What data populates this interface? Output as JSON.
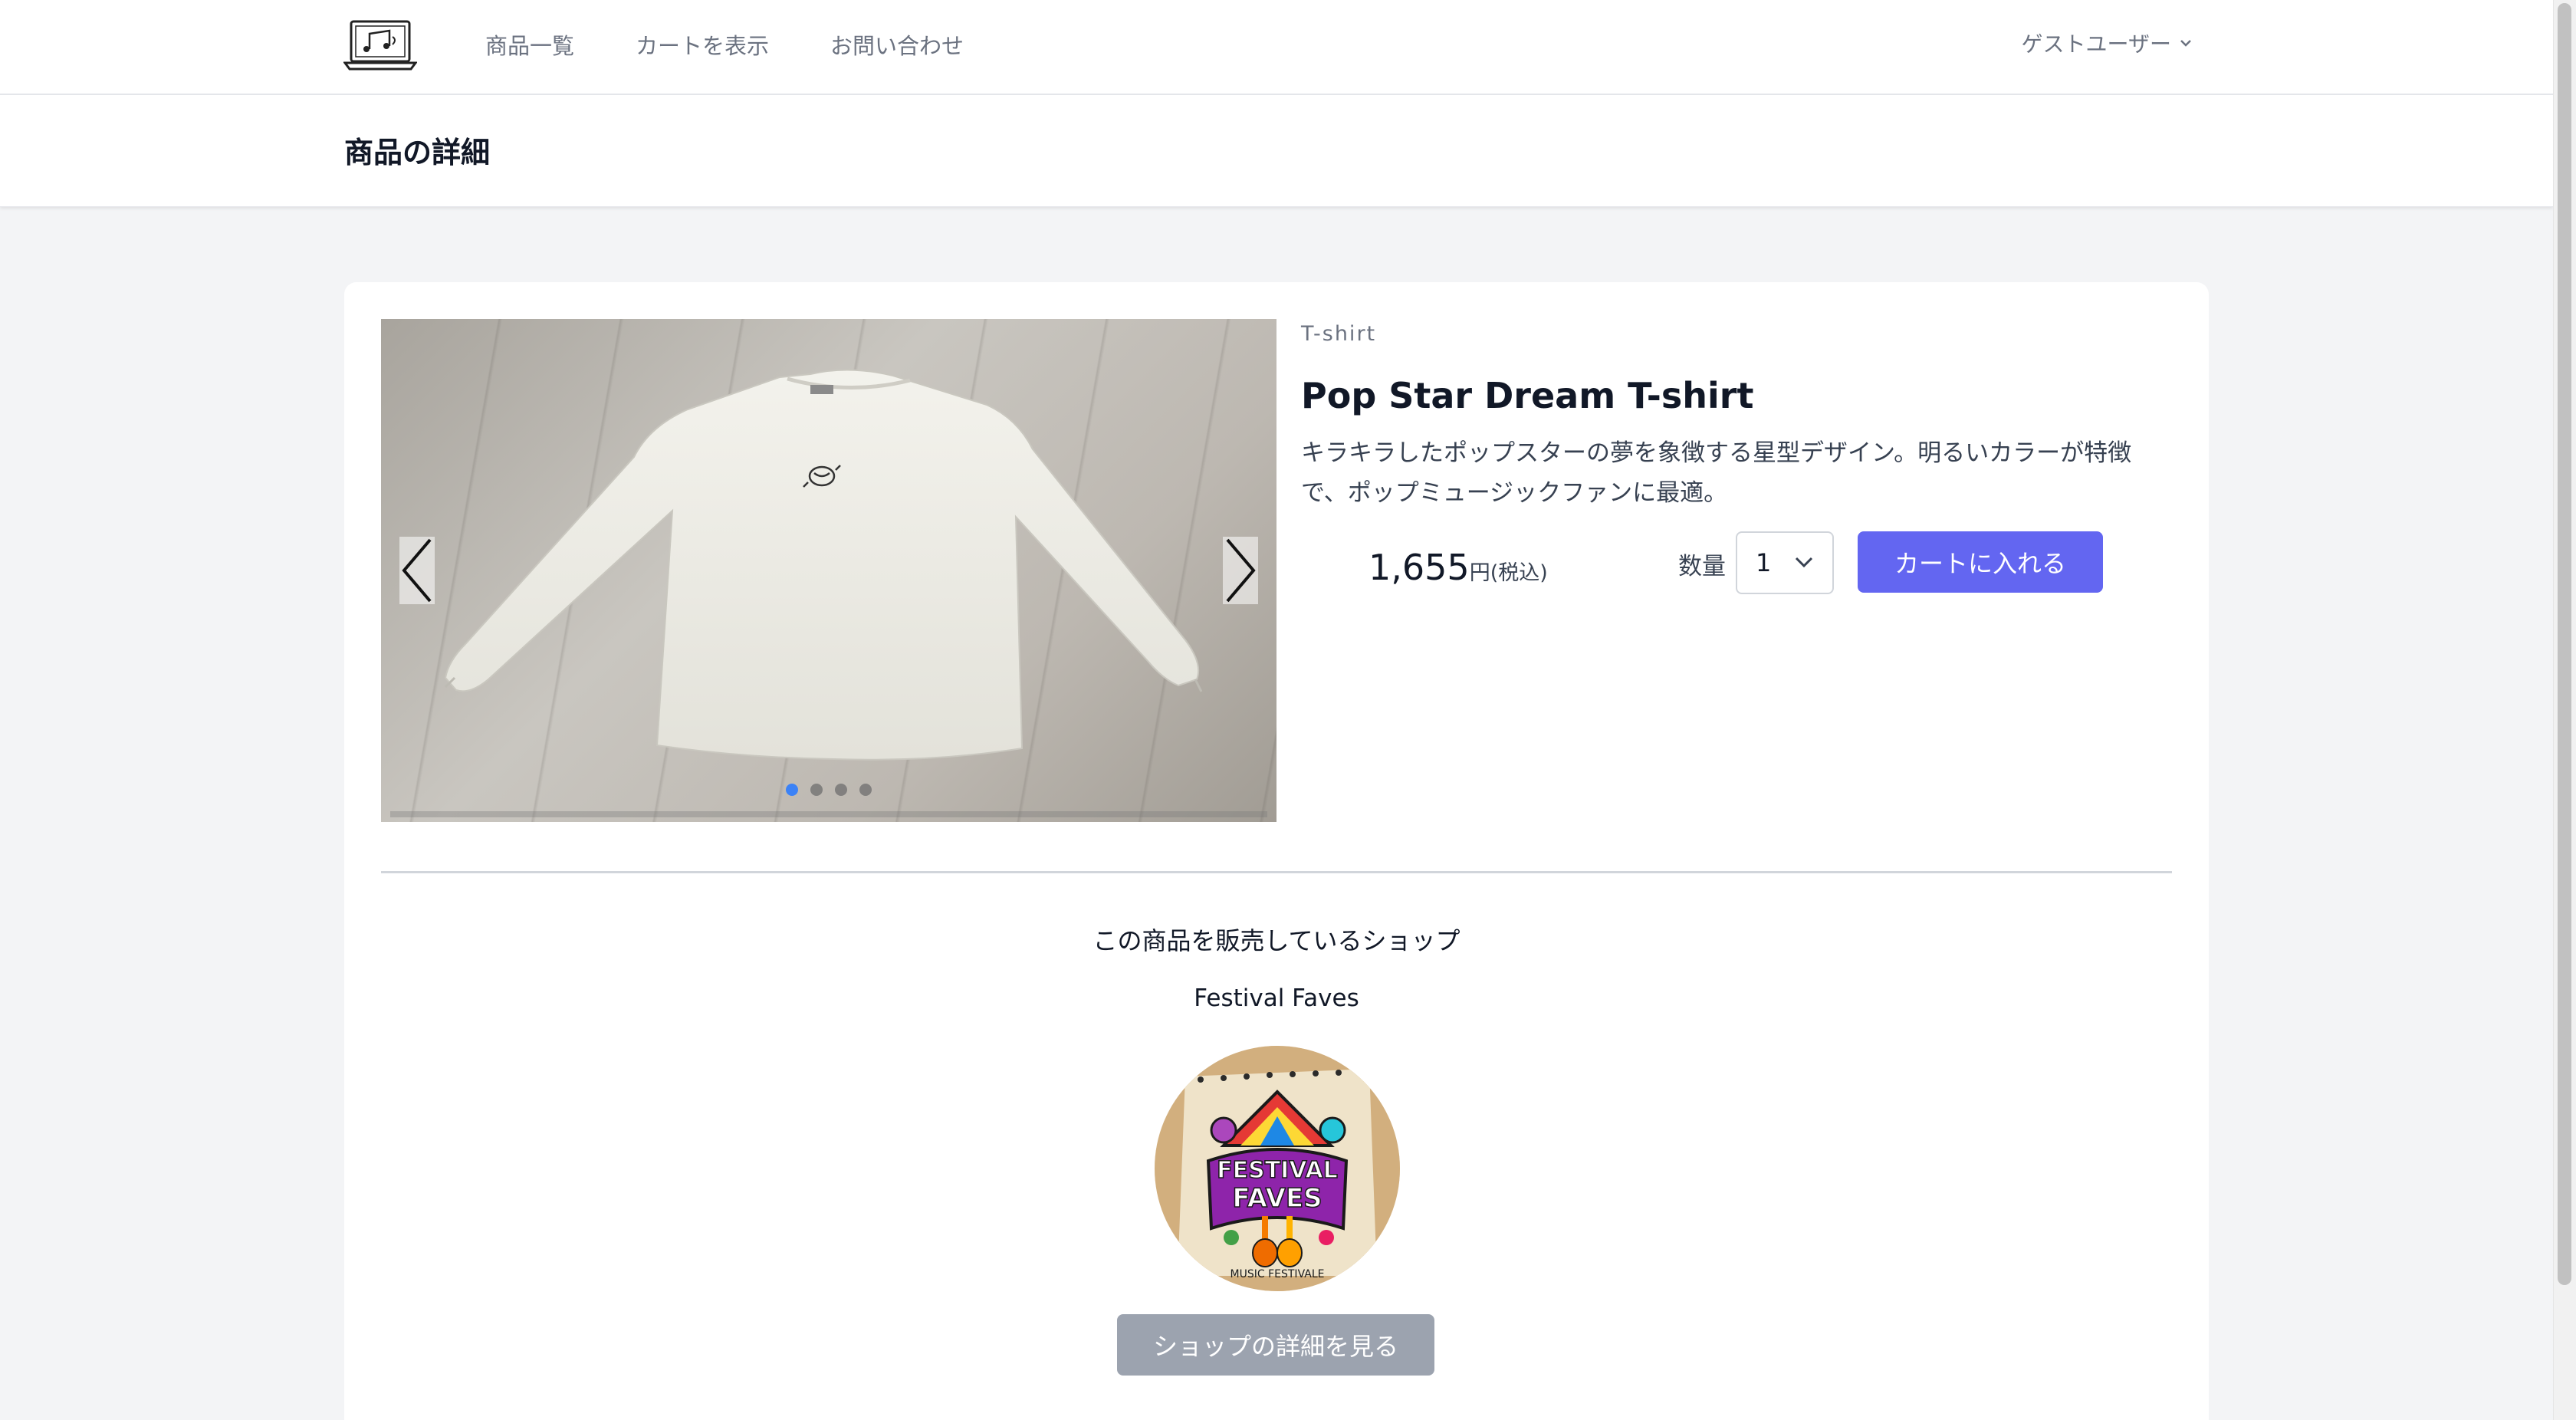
{
  "nav": {
    "links": [
      "商品一覧",
      "カートを表示",
      "お問い合わせ"
    ],
    "user_menu": "ゲストユーザー"
  },
  "header": {
    "title": "商品の詳細"
  },
  "product": {
    "category": "T-shirt",
    "name": "Pop Star Dream T-shirt",
    "description": "キラキラしたポップスターの夢を象徴する星型デザイン。明るいカラーが特徴で、ポップミュージックファンに最適。",
    "price": "1,655",
    "price_unit": "円(税込)",
    "quantity_label": "数量",
    "quantity_value": "1",
    "add_to_cart_label": "カートに入れる",
    "carousel_slides": 4,
    "active_slide": 1
  },
  "shop": {
    "heading": "この商品を販売しているショップ",
    "name": "Festival Faves",
    "logo_text": [
      "FESTIVAL",
      "FAVES",
      "MUSIC FESTIVALE"
    ],
    "details_button_label": "ショップの詳細を見る"
  },
  "colors": {
    "primary": "#6366f1",
    "active_dot": "#3b82f6",
    "disabled_button": "#9ca3af"
  }
}
